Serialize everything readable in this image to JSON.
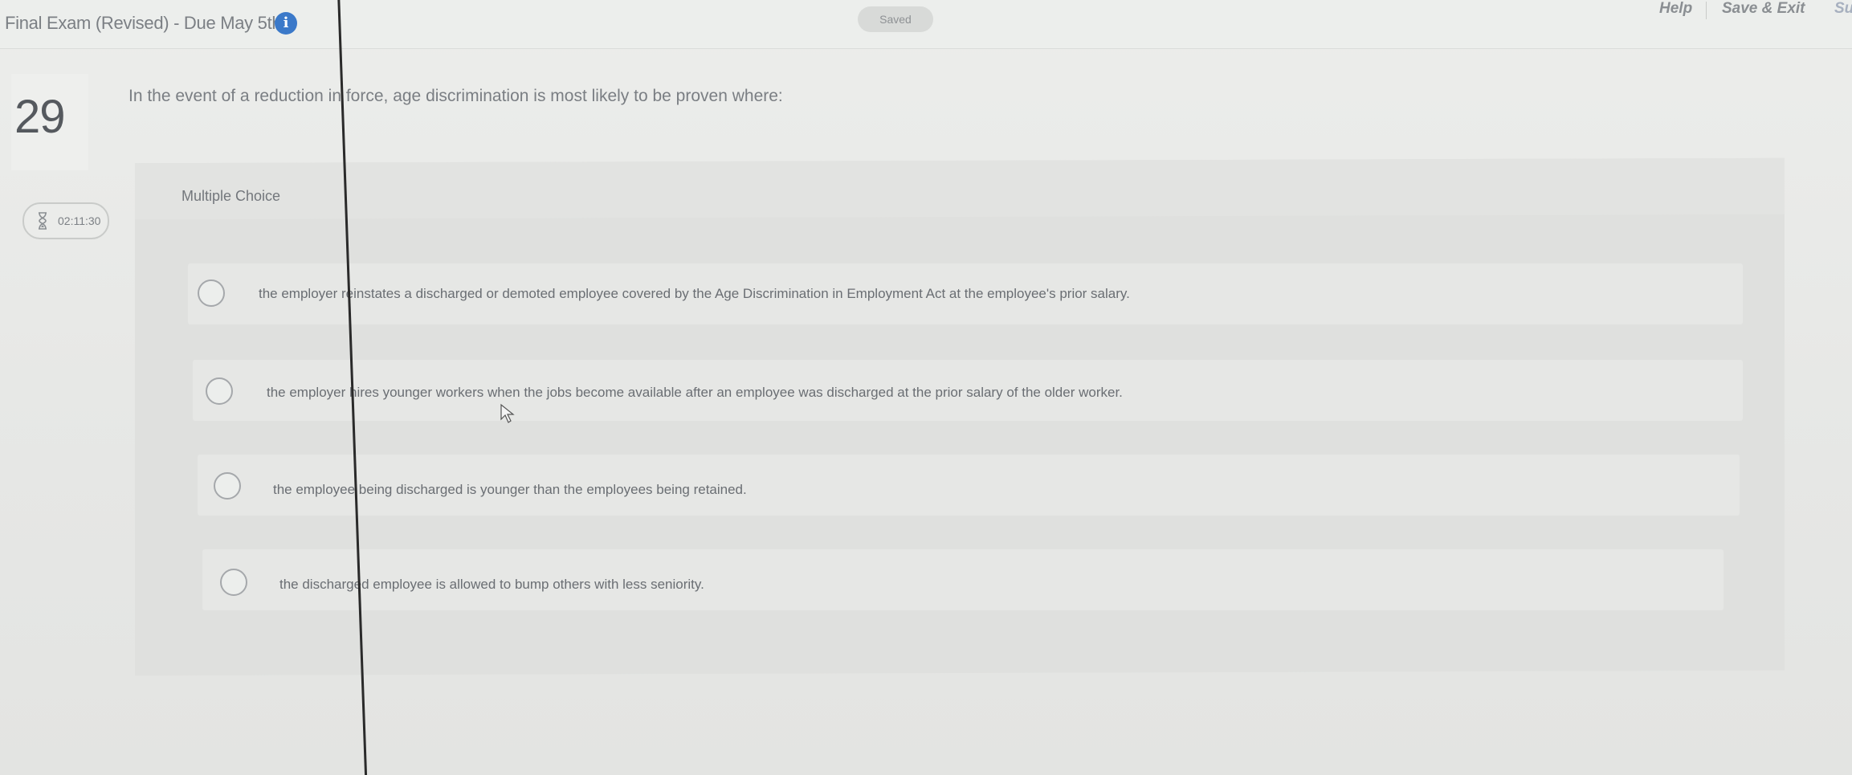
{
  "header": {
    "exam_title": "Final Exam (Revised) - Due May 5th",
    "info_icon": "info-icon",
    "saved_label": "Saved",
    "help_label": "Help",
    "save_exit_label": "Save & Exit",
    "submit_label": "Su"
  },
  "question": {
    "number": "29",
    "timer": "02:11:30",
    "text": "In the event of a reduction in force, age discrimination is most likely to be proven where:",
    "type_label": "Multiple Choice"
  },
  "options": [
    {
      "text": "the employer reinstates a discharged or demoted employee covered by the Age Discrimination in Employment Act at the employee's prior salary."
    },
    {
      "text": "the employer hires younger workers when the jobs become available after an employee was discharged at the prior salary of the older worker."
    },
    {
      "text": "the employee being discharged is younger than the employees being retained."
    },
    {
      "text": "the discharged employee is allowed to bump others with less seniority."
    }
  ],
  "colors": {
    "info_blue": "#3b79c9",
    "background": "#e7e8e6"
  }
}
